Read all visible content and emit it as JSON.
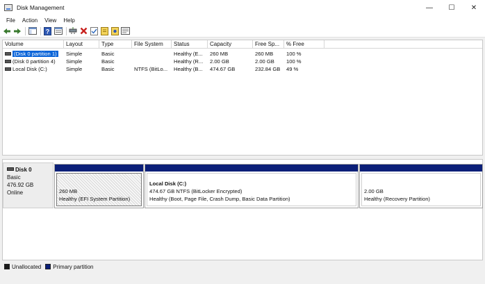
{
  "window": {
    "title": "Disk Management",
    "minimize": "—",
    "maximize": "☐",
    "close": "✕"
  },
  "menu": [
    "File",
    "Action",
    "View",
    "Help"
  ],
  "toolbar_icons": [
    "back-icon",
    "forward-icon",
    "console-tree-icon",
    "help-icon",
    "properties-icon",
    "connect-drive-icon",
    "delete-icon",
    "check-icon",
    "new-volume-icon",
    "format-icon",
    "rescan-icon"
  ],
  "volumes": {
    "headers": [
      "Volume",
      "Layout",
      "Type",
      "File System",
      "Status",
      "Capacity",
      "Free Sp...",
      "% Free"
    ],
    "rows": [
      [
        "(Disk 0 partition 1)",
        "Simple",
        "Basic",
        "",
        "Healthy (E...",
        "260 MB",
        "260 MB",
        "100 %"
      ],
      [
        "(Disk 0 partition 4)",
        "Simple",
        "Basic",
        "",
        "Healthy (R...",
        "2.00 GB",
        "2.00 GB",
        "100 %"
      ],
      [
        "Local Disk (C:)",
        "Simple",
        "Basic",
        "NTFS (BitLo...",
        "Healthy (B...",
        "474.67 GB",
        "232.84 GB",
        "49 %"
      ]
    ]
  },
  "disk": {
    "name": "Disk 0",
    "type": "Basic",
    "size": "476.92 GB",
    "state": "Online",
    "partitions": [
      {
        "title": "",
        "line1": "260 MB",
        "line2": "Healthy (EFI System Partition)"
      },
      {
        "title": "Local Disk  (C:)",
        "line1": "474.67 GB NTFS (BitLocker Encrypted)",
        "line2": "Healthy (Boot, Page File, Crash Dump, Basic Data Partition)"
      },
      {
        "title": "",
        "line1": "2.00 GB",
        "line2": "Healthy (Recovery Partition)"
      }
    ]
  },
  "legend": {
    "unallocated": "Unallocated",
    "primary": "Primary partition",
    "colors": {
      "unallocated": "#1a1a1a",
      "primary": "#0b1f78"
    }
  },
  "colors": {
    "selection": "#0a64d8",
    "partition_bar": "#0b1f78"
  }
}
